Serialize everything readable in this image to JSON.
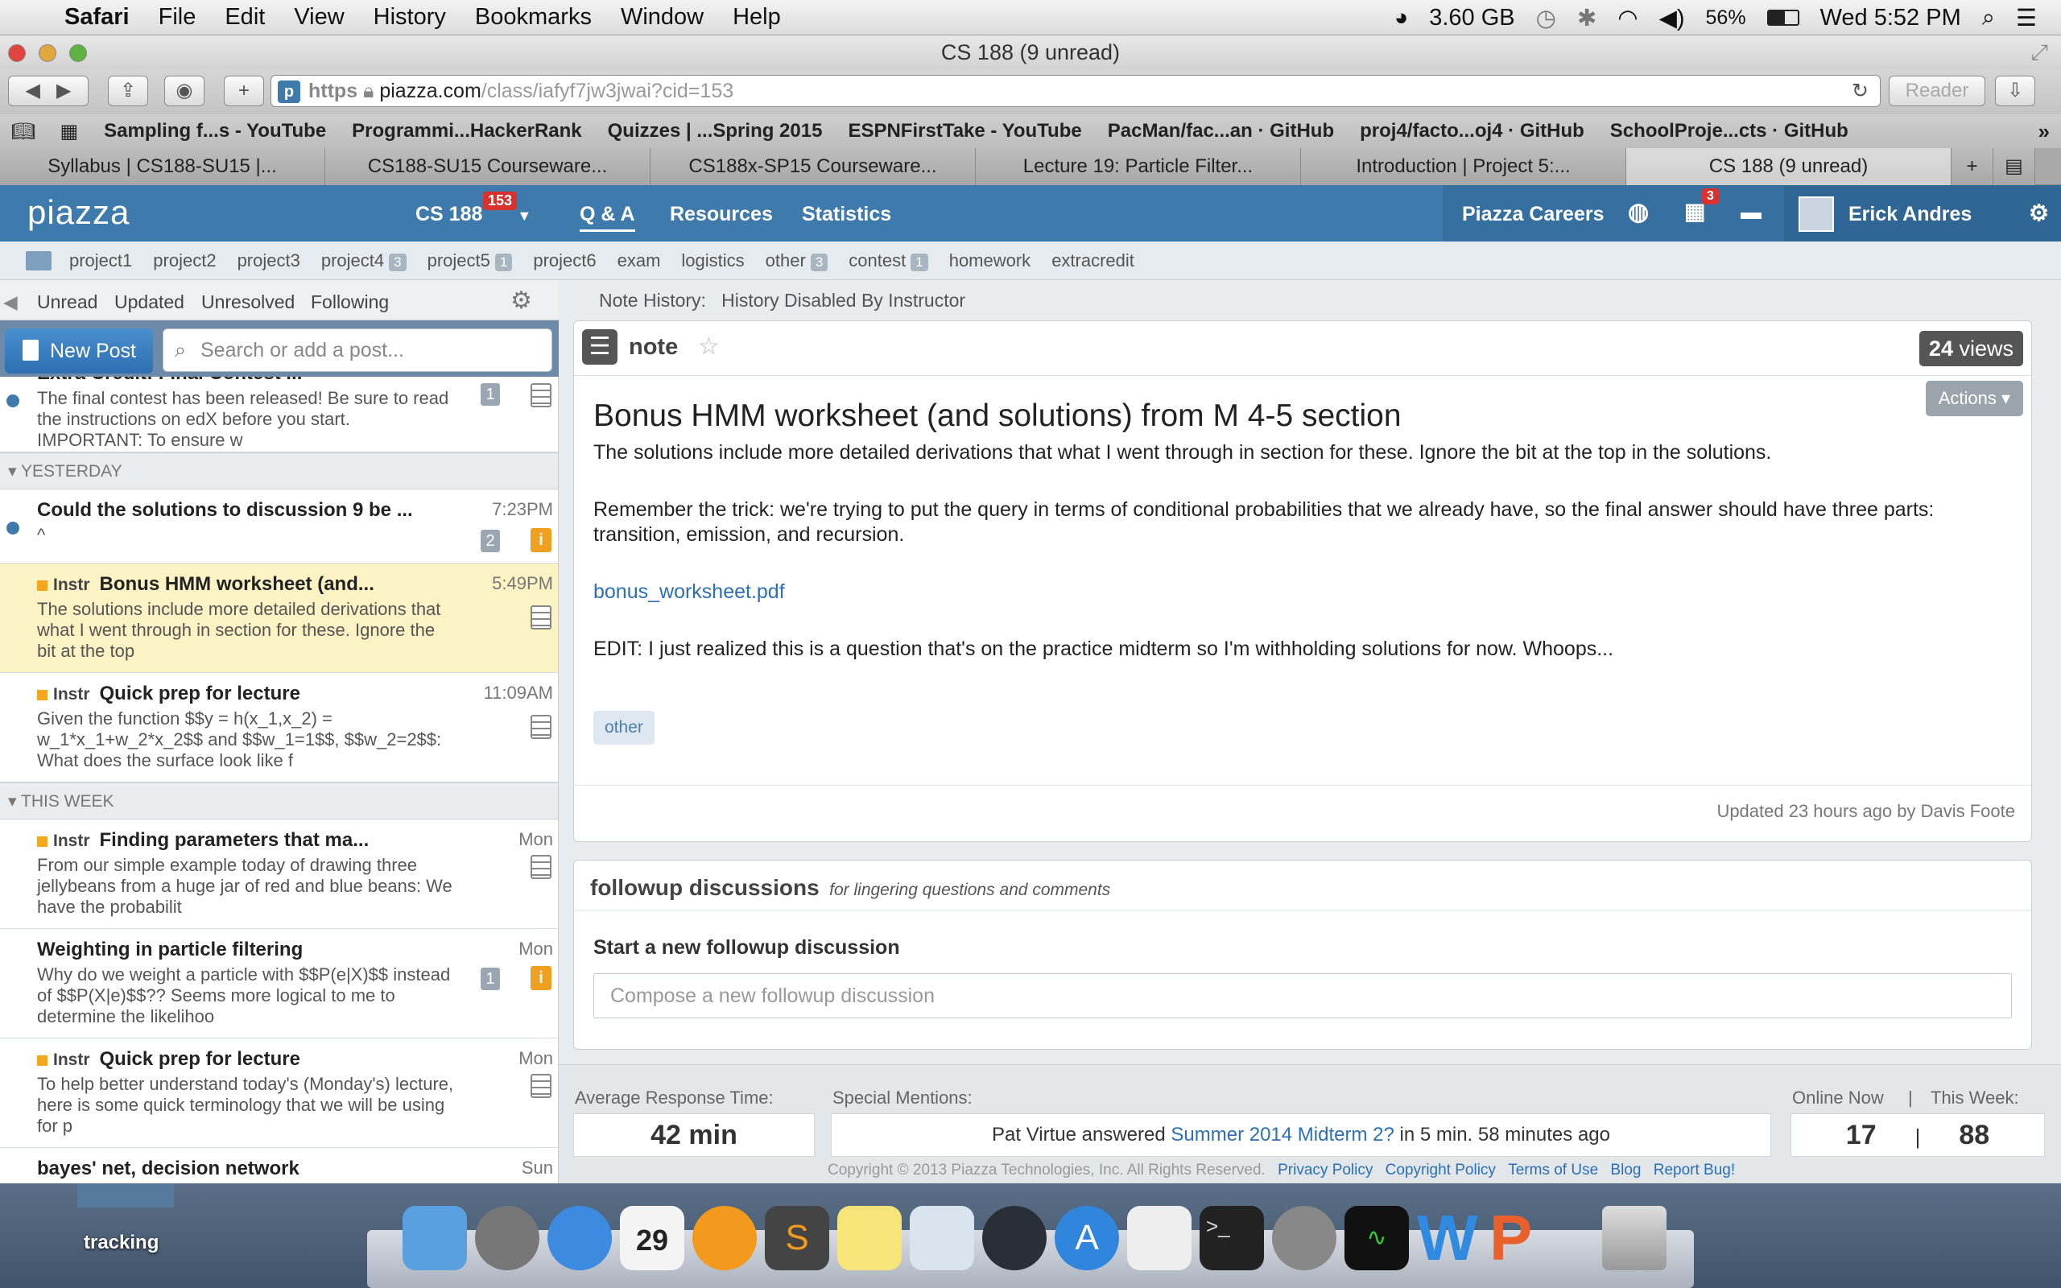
{
  "menubar": {
    "app": "Safari",
    "items": [
      "File",
      "Edit",
      "View",
      "History",
      "Bookmarks",
      "Window",
      "Help"
    ],
    "memory": "3.60 GB",
    "battery": "56%",
    "clock": "Wed 5:52 PM"
  },
  "window": {
    "title": "CS 188 (9 unread)"
  },
  "toolbar": {
    "url_scheme": "https",
    "url_host": "piazza.com",
    "url_path": "/class/iafyf7jw3jwai?cid=153",
    "reader": "Reader"
  },
  "bookmarks": [
    "Sampling f...s - YouTube",
    "Programmi...HackerRank",
    "Quizzes | ...Spring 2015",
    "ESPNFirstTake - YouTube",
    "PacMan/fac...an · GitHub",
    "proj4/facto...oj4 · GitHub",
    "SchoolProje...cts · GitHub"
  ],
  "tabs": [
    "Syllabus | CS188-SU15 |...",
    "CS188-SU15 Courseware...",
    "CS188x-SP15 Courseware...",
    "Lecture 19: Particle Filter...",
    "Introduction | Project 5:...",
    "CS 188 (9 unread)"
  ],
  "piazza": {
    "logo": "piazza",
    "course": "CS 188",
    "course_badge": "153",
    "nav": [
      "Q & A",
      "Resources",
      "Statistics"
    ],
    "careers": "Piazza Careers",
    "notif_badge": "3",
    "user": "Erick Andres"
  },
  "folders": [
    {
      "name": "project1",
      "count": ""
    },
    {
      "name": "project2",
      "count": ""
    },
    {
      "name": "project3",
      "count": ""
    },
    {
      "name": "project4",
      "count": "3"
    },
    {
      "name": "project5",
      "count": "1"
    },
    {
      "name": "project6",
      "count": ""
    },
    {
      "name": "exam",
      "count": ""
    },
    {
      "name": "logistics",
      "count": ""
    },
    {
      "name": "other",
      "count": "3"
    },
    {
      "name": "contest",
      "count": "1"
    },
    {
      "name": "homework",
      "count": ""
    },
    {
      "name": "extracredit",
      "count": ""
    }
  ],
  "feed_filters": [
    "Unread",
    "Updated",
    "Unresolved",
    "Following"
  ],
  "new_post": "New Post",
  "search_placeholder": "Search or add a post...",
  "feed": {
    "top_item": {
      "title": "Extra Credit: Final Contest ...",
      "snippet": "The final contest has been released! Be sure to read the instructions on edX before you start. IMPORTANT:  To ensure w",
      "count": "1"
    },
    "section_yesterday": "YESTERDAY",
    "item1": {
      "title": "Could the solutions to discussion 9 be ...",
      "snippet": "^",
      "time": "7:23PM",
      "count": "2"
    },
    "item2": {
      "tag": "Instr",
      "title": "Bonus HMM worksheet (and...",
      "snippet": "The solutions include more detailed derivations that what I went through in section for these. Ignore the bit at the top",
      "time": "5:49PM"
    },
    "item3": {
      "tag": "Instr",
      "title": "Quick prep for lecture",
      "snippet": "Given the function $$y = h(x_1,x_2) = w_1*x_1+w_2*x_2$$ and $$w_1=1$$, $$w_2=2$$: What does the surface look like f",
      "time": "11:09AM"
    },
    "section_week": "THIS WEEK",
    "item4": {
      "tag": "Instr",
      "title": "Finding parameters that ma...",
      "snippet": "From our simple example today of drawing three jellybeans from a huge jar of red and blue beans: We have the probabilit",
      "time": "Mon"
    },
    "item5": {
      "title": "Weighting in particle filtering",
      "snippet": "Why do we weight a particle with $$P(e|X)$$ instead of $$P(X|e)$$?? Seems more logical to me to determine the likelihoo",
      "time": "Mon",
      "count": "1"
    },
    "item6": {
      "tag": "Instr",
      "title": "Quick prep for lecture",
      "snippet": "To help better understand today's (Monday's) lecture, here is some quick terminology that we will be using for p",
      "time": "Mon"
    },
    "item7": {
      "title": "bayes' net, decision network",
      "time": "Sun"
    }
  },
  "note": {
    "history_label": "Note History:",
    "history_value": "History Disabled By Instructor",
    "type": "note",
    "views_num": "24",
    "views_label": "views",
    "actions": "Actions",
    "title": "Bonus HMM worksheet (and solutions) from M 4-5 section",
    "p1": "The solutions include more detailed derivations that what I went through in section for these. Ignore the bit at the top in the solutions.",
    "p2": "Remember the trick: we're trying to put the query in terms of conditional probabilities that we already have, so the final answer should have three parts: transition, emission, and recursion.",
    "link": "bonus_worksheet.pdf",
    "p3": "EDIT: I just realized this is a question that's on the practice midterm so I'm withholding solutions for now. Whoops...",
    "tag": "other",
    "updated": "Updated 23 hours ago by Davis Foote"
  },
  "followup": {
    "title": "followup discussions",
    "subtitle": "for lingering questions and comments",
    "start": "Start a new followup discussion",
    "placeholder": "Compose a new followup discussion"
  },
  "stats": {
    "avg_label": "Average Response Time:",
    "avg_value": "42 min",
    "special_label": "Special Mentions:",
    "special_prefix": "Pat Virtue answered",
    "special_link": "Summer 2014 Midterm 2?",
    "special_suffix": "in 5 min. 58 minutes ago",
    "online_label": "Online Now",
    "week_label": "This Week:",
    "sep": "|",
    "online_value": "17",
    "week_value": "88"
  },
  "footer": {
    "copyright": "Copyright © 2013 Piazza Technologies, Inc. All Rights Reserved.",
    "links": [
      "Privacy Policy",
      "Copyright Policy",
      "Terms of Use",
      "Blog",
      "Report Bug!"
    ]
  },
  "desktop": {
    "label": "tracking"
  }
}
